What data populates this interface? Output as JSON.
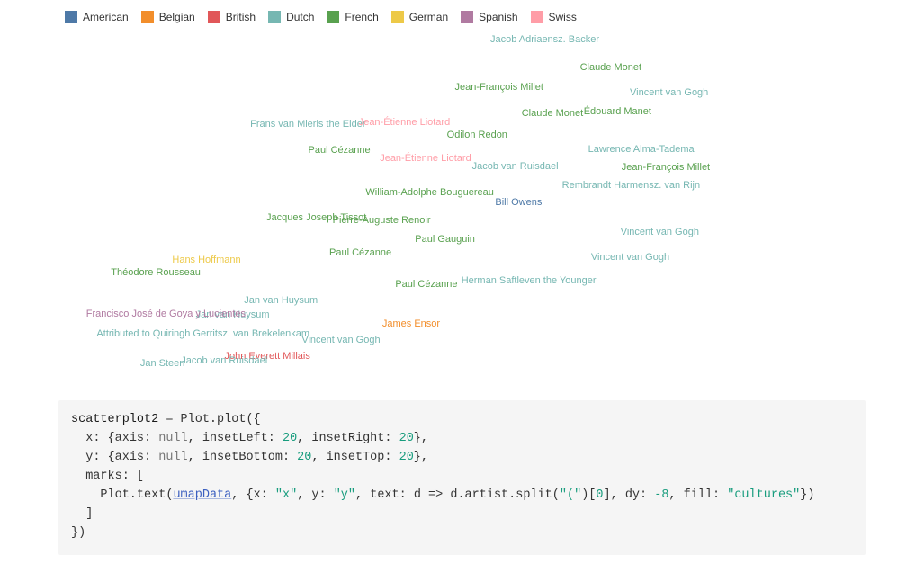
{
  "legend": {
    "items": [
      {
        "label": "American",
        "color": "#4e79a7"
      },
      {
        "label": "Belgian",
        "color": "#f28e2b"
      },
      {
        "label": "British",
        "color": "#e15759"
      },
      {
        "label": "Dutch",
        "color": "#76b7b2"
      },
      {
        "label": "French",
        "color": "#59a14f"
      },
      {
        "label": "German",
        "color": "#edc948"
      },
      {
        "label": "Spanish",
        "color": "#b07aa1"
      },
      {
        "label": "Swiss",
        "color": "#ff9da7"
      }
    ]
  },
  "chart_data": {
    "type": "scatter",
    "title": "",
    "xlabel": "",
    "ylabel": "",
    "xlim": [
      0,
      10
    ],
    "ylim": [
      0,
      10
    ],
    "series": [
      {
        "name": "American",
        "color": "#4e79a7",
        "points": [
          {
            "x": 5.44,
            "y": 5.01,
            "label": "Bill Owens"
          }
        ]
      },
      {
        "name": "Belgian",
        "color": "#f28e2b",
        "points": [
          {
            "x": 4.17,
            "y": 1.6,
            "label": "James Ensor"
          }
        ]
      },
      {
        "name": "British",
        "color": "#e15759",
        "points": [
          {
            "x": 2.47,
            "y": 0.69,
            "label": "John Everett Millais"
          }
        ]
      },
      {
        "name": "Dutch",
        "color": "#76b7b2",
        "points": [
          {
            "x": 5.75,
            "y": 9.59,
            "label": "Jacob Adriaensz. Backer"
          },
          {
            "x": 7.22,
            "y": 8.1,
            "label": "Vincent van Gogh"
          },
          {
            "x": 2.95,
            "y": 7.22,
            "label": "Frans van Mieris the Elder"
          },
          {
            "x": 6.89,
            "y": 6.51,
            "label": "Lawrence Alma-Tadema"
          },
          {
            "x": 5.4,
            "y": 6.03,
            "label": "Jacob van Ruisdael"
          },
          {
            "x": 6.77,
            "y": 5.49,
            "label": "Rembrandt Harmensz. van Rijn"
          },
          {
            "x": 7.11,
            "y": 4.18,
            "label": "Vincent van Gogh"
          },
          {
            "x": 6.76,
            "y": 3.46,
            "label": "Vincent van Gogh"
          },
          {
            "x": 5.56,
            "y": 2.82,
            "label": "Herman Saftleven the Younger"
          },
          {
            "x": 2.63,
            "y": 2.26,
            "label": "Jan van Huysum"
          },
          {
            "x": 2.06,
            "y": 1.86,
            "label": "Jan van Huysum"
          },
          {
            "x": 1.71,
            "y": 1.31,
            "label": "Attributed to Quiringh Gerritsz. van Brekelenkam"
          },
          {
            "x": 3.34,
            "y": 1.13,
            "label": "Vincent van Gogh"
          },
          {
            "x": 1.96,
            "y": 0.56,
            "label": "Jacob van Ruisdael"
          },
          {
            "x": 1.23,
            "y": 0.49,
            "label": "Jan Steen"
          }
        ]
      },
      {
        "name": "French",
        "color": "#59a14f",
        "points": [
          {
            "x": 6.53,
            "y": 8.82,
            "label": "Claude Monet"
          },
          {
            "x": 5.21,
            "y": 8.26,
            "label": "Jean-François Millet"
          },
          {
            "x": 5.84,
            "y": 7.51,
            "label": "Claude Monet"
          },
          {
            "x": 6.61,
            "y": 7.56,
            "label": "Édouard Manet"
          },
          {
            "x": 4.95,
            "y": 6.9,
            "label": "Odilon Redon"
          },
          {
            "x": 3.32,
            "y": 6.49,
            "label": "Paul Cézanne"
          },
          {
            "x": 7.18,
            "y": 6.0,
            "label": "Jean-François Millet"
          },
          {
            "x": 4.39,
            "y": 5.28,
            "label": "William-Adolphe Bouguereau"
          },
          {
            "x": 3.05,
            "y": 4.57,
            "label": "Jacques Joseph Tissot"
          },
          {
            "x": 3.82,
            "y": 4.51,
            "label": "Pierre-Auguste Renoir"
          },
          {
            "x": 4.57,
            "y": 3.97,
            "label": "Paul Gauguin"
          },
          {
            "x": 3.57,
            "y": 3.59,
            "label": "Paul Cézanne"
          },
          {
            "x": 1.15,
            "y": 3.03,
            "label": "Théodore Rousseau"
          },
          {
            "x": 4.35,
            "y": 2.72,
            "label": "Paul Cézanne"
          }
        ]
      },
      {
        "name": "German",
        "color": "#edc948",
        "points": [
          {
            "x": 1.75,
            "y": 3.38,
            "label": "Hans Hoffmann"
          }
        ]
      },
      {
        "name": "Spanish",
        "color": "#b07aa1",
        "points": [
          {
            "x": 1.27,
            "y": 1.87,
            "label": "Francisco José de Goya y Lucientes"
          }
        ]
      },
      {
        "name": "Swiss",
        "color": "#ff9da7",
        "points": [
          {
            "x": 4.09,
            "y": 7.26,
            "label": "Jean-Étienne Liotard"
          },
          {
            "x": 4.34,
            "y": 6.26,
            "label": "Jean-Étienne Liotard"
          }
        ]
      }
    ]
  },
  "code": {
    "var": "scatterplot2",
    "assign": " = ",
    "plot_call": "Plot.plot",
    "x_key": "x",
    "y_key": "y",
    "marks_key": "marks",
    "axis_key": "axis",
    "null_val": "null",
    "insetLeft_key": "insetLeft",
    "insetRight_key": "insetRight",
    "insetBottom_key": "insetBottom",
    "insetTop_key": "insetTop",
    "inset_val": "20",
    "text_call": "Plot.text",
    "umap": "umapData",
    "text_key": "text",
    "arrow": " => ",
    "d_artist": "d.artist.split",
    "paren_str": "\"(\"",
    "idx": "0",
    "dy_key": "dy",
    "dy_val": "-8",
    "fill_key": "fill",
    "fill_val": "\"cultures\""
  }
}
